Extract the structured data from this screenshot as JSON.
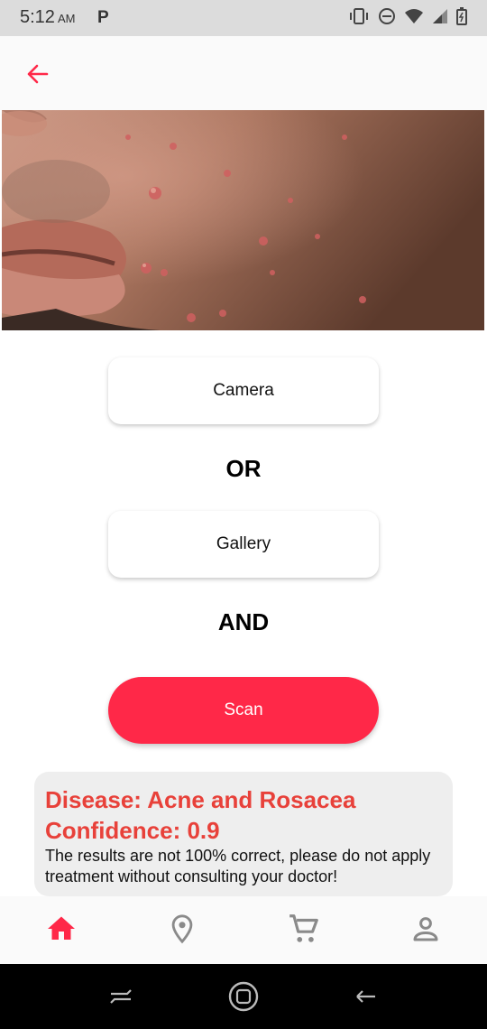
{
  "status_bar": {
    "time": "5:12",
    "ampm": "AM",
    "notification": "P"
  },
  "image": {
    "subject": "acne-skin-photo"
  },
  "actions": {
    "camera_label": "Camera",
    "or_label": "OR",
    "gallery_label": "Gallery",
    "and_label": "AND",
    "scan_label": "Scan"
  },
  "result": {
    "disease_text": "Disease: Acne and Rosacea",
    "confidence_text": "Confidence: 0.9",
    "disclaimer": "The results are not 100% correct, please do not apply treatment without consulting your doctor!"
  },
  "nav": {
    "items": [
      {
        "icon": "home-icon",
        "active": true
      },
      {
        "icon": "location-pin-icon",
        "active": false
      },
      {
        "icon": "cart-icon",
        "active": false
      },
      {
        "icon": "person-icon",
        "active": false
      }
    ]
  },
  "colors": {
    "accent": "#ff2848",
    "result_text": "#e8413a",
    "nav_inactive": "#8a8a8a"
  }
}
